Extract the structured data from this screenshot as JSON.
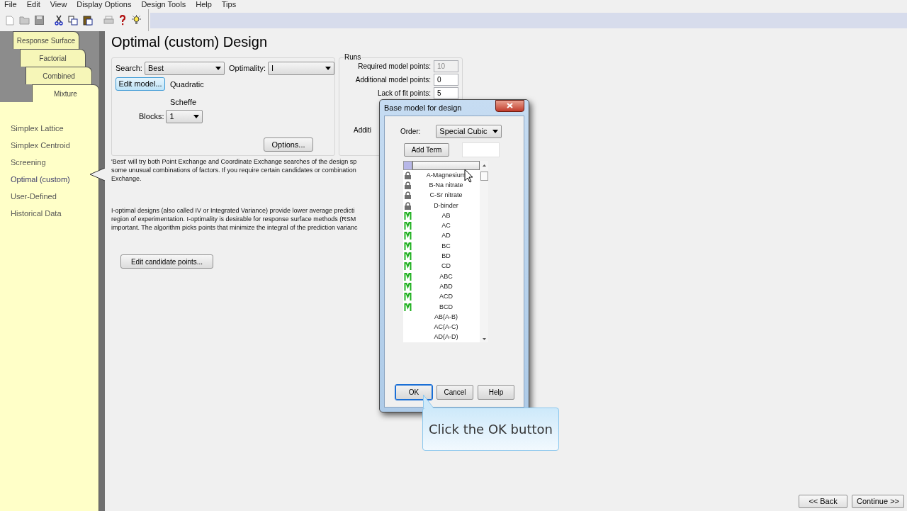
{
  "menu": [
    "File",
    "Edit",
    "View",
    "Display Options",
    "Design Tools",
    "Help",
    "Tips"
  ],
  "tabs": [
    {
      "label": "Response Surface",
      "selected": false
    },
    {
      "label": "Factorial",
      "selected": false
    },
    {
      "label": "Combined",
      "selected": false
    },
    {
      "label": "Mixture",
      "selected": true
    }
  ],
  "design_types": [
    {
      "label": "Simplex Lattice",
      "selected": false
    },
    {
      "label": "Simplex Centroid",
      "selected": false
    },
    {
      "label": "Screening",
      "selected": false
    },
    {
      "label": "Optimal (custom)",
      "selected": true
    },
    {
      "label": "User-Defined",
      "selected": false
    },
    {
      "label": "Historical Data",
      "selected": false
    }
  ],
  "title": "Optimal (custom) Design",
  "search": {
    "label": "Search:",
    "value": "Best"
  },
  "optimality": {
    "label": "Optimality:",
    "value": "I"
  },
  "edit_model_button": {
    "label": "Edit model...",
    "highlighted": true
  },
  "model_order": "Quadratic",
  "model_type": "Scheffe",
  "blocks": {
    "label": "Blocks:",
    "value": "1"
  },
  "options_button": "Options...",
  "runs": {
    "title": "Runs",
    "fields": [
      {
        "label": "Required model points:",
        "value": "10",
        "disabled": true
      },
      {
        "label": "Additional model points:",
        "value": "0",
        "disabled": false
      },
      {
        "label": "Lack of fit points:",
        "value": "5",
        "disabled": false
      },
      {
        "label": "Additi"
      }
    ]
  },
  "description": [
    [
      "'Best' will try both Point Exchange and Coordinate Exchange searches of the design sp",
      "some unusual combinations of factors. If you require certain candidates or combination",
      "Exchange."
    ],
    [
      "I-optimal designs (also called IV or Integrated Variance) provide lower average predicti",
      "region of experimentation.  I-optimality is desirable for response surface methods (RSM",
      "important.  The algorithm picks points that minimize the integral of the prediction varianc"
    ]
  ],
  "candidate_button": "Edit candidate points...",
  "dialog": {
    "title": "Base model for design",
    "order": {
      "label": "Order:",
      "value": "Special Cubic"
    },
    "add_term_button": "Add Term",
    "terms": [
      {
        "name": "A-Magnesium",
        "kind": "lock"
      },
      {
        "name": "B-Na nitrate",
        "kind": "lock"
      },
      {
        "name": "C-Sr nitrate",
        "kind": "lock"
      },
      {
        "name": "D-binder",
        "kind": "lock"
      },
      {
        "name": "AB",
        "kind": "model"
      },
      {
        "name": "AC",
        "kind": "model"
      },
      {
        "name": "AD",
        "kind": "model"
      },
      {
        "name": "BC",
        "kind": "model"
      },
      {
        "name": "BD",
        "kind": "model"
      },
      {
        "name": "CD",
        "kind": "model"
      },
      {
        "name": "ABC",
        "kind": "model"
      },
      {
        "name": "ABD",
        "kind": "model"
      },
      {
        "name": "ACD",
        "kind": "model"
      },
      {
        "name": "BCD",
        "kind": "model"
      },
      {
        "name": "AB(A-B)",
        "kind": "plain"
      },
      {
        "name": "AC(A-C)",
        "kind": "plain"
      },
      {
        "name": "AD(A-D)",
        "kind": "plain"
      }
    ],
    "buttons": [
      {
        "label": "OK",
        "focused": true
      },
      {
        "label": "Cancel",
        "focused": false
      },
      {
        "label": "Help",
        "focused": false
      }
    ]
  },
  "callout": "Click the OK button",
  "nav_buttons": [
    "<< Back",
    "Continue >>"
  ]
}
